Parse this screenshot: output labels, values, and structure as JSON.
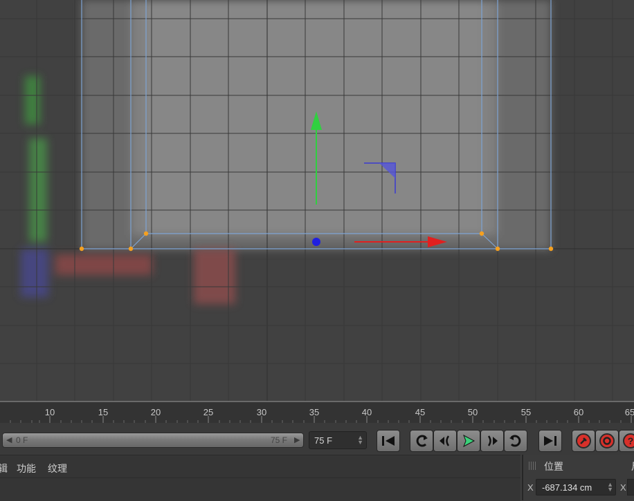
{
  "viewport": {
    "colors": {
      "background": "#3f3f3f",
      "grid": "#353535",
      "mesh": "#8c8c8c",
      "outline": "#7aa0d0",
      "point": "#f5a020",
      "x_axis": "#e02020",
      "y_axis": "#30d040",
      "z_axis": "#2020e0"
    }
  },
  "timeline": {
    "ticks": [
      "10",
      "15",
      "20",
      "25",
      "30",
      "35",
      "40",
      "45",
      "50",
      "55",
      "60",
      "65"
    ]
  },
  "transport": {
    "range_start": "0 F",
    "range_end": "75 F",
    "current_frame": "75 F",
    "buttons": [
      "go-to-start",
      "previous-key",
      "play-backwards",
      "play-forwards",
      "next-key",
      "loop",
      "go-to-end"
    ],
    "record_buttons": [
      "record-active",
      "autokey",
      "keyframe-selection"
    ]
  },
  "menu": {
    "items": [
      "辑",
      "功能",
      "纹理"
    ]
  },
  "attributes": {
    "header": "位置",
    "header_right": "尺",
    "axis_x": "X",
    "pos_x": "-687.134 cm",
    "axis_x2": "X"
  }
}
